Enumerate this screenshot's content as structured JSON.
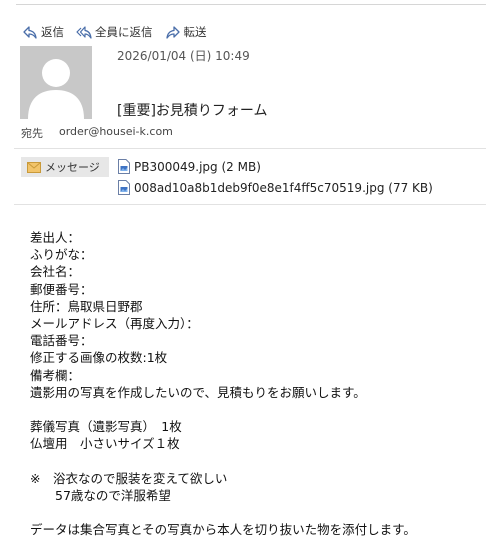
{
  "toolbar": {
    "reply_label": "返信",
    "reply_all_label": "全員に返信",
    "forward_label": "転送"
  },
  "header": {
    "datetime": "2026/01/04 (日) 10:49",
    "subject": "[重要]お見積りフォーム",
    "to_label": "宛先",
    "to_address": "order@housei-k.com"
  },
  "attachments": {
    "message_tab_label": "メッセージ",
    "files": [
      "PB300049.jpg (2 MB)",
      "008ad10a8b1deb9f0e8e1f4ff5c70519.jpg (77 KB)"
    ]
  },
  "body_lines": [
    "差出人：",
    "ふりがな：",
    "会社名：",
    "郵便番号：",
    "住所：鳥取県日野郡",
    "メールアドレス（再度入力）：",
    "電話番号：",
    "修正する画像の枚数:1枚",
    "備考欄：",
    "遺影用の写真を作成したいので、見積もりをお願いします。",
    "",
    "葬儀写真（遺影写真）　1枚",
    "仏壇用　小さいサイズ１枚",
    "",
    "※　浴衣なので服装を変えて欲しい",
    "　　57歳なので洋服希望",
    "",
    "データは集合写真とその写真から本人を切り抜いた物を添付します。"
  ]
}
